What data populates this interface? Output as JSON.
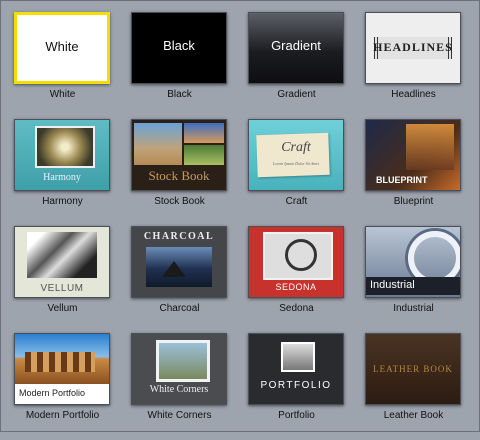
{
  "themes": [
    {
      "label": "White",
      "title": "White",
      "selected": true
    },
    {
      "label": "Black",
      "title": "Black"
    },
    {
      "label": "Gradient",
      "title": "Gradient"
    },
    {
      "label": "Headlines",
      "title": "HEADLINES"
    },
    {
      "label": "Harmony",
      "title": "Harmony"
    },
    {
      "label": "Stock Book",
      "title": "Stock Book"
    },
    {
      "label": "Craft",
      "title": "Craft",
      "subtitle": "Lorem Ipsum Dolor Sit Amet"
    },
    {
      "label": "Blueprint",
      "title": "BLUEPRINT"
    },
    {
      "label": "Vellum",
      "title": "VELLUM"
    },
    {
      "label": "Charcoal",
      "title": "CHARCOAL"
    },
    {
      "label": "Sedona",
      "title": "SEDONA"
    },
    {
      "label": "Industrial",
      "title": "Industrial"
    },
    {
      "label": "Modern Portfolio",
      "title": "Modern Portfolio"
    },
    {
      "label": "White Corners",
      "title": "White Corners"
    },
    {
      "label": "Portfolio",
      "title": "PORTFOLIO"
    },
    {
      "label": "Leather Book",
      "title": "LEATHER BOOK"
    }
  ],
  "colors": {
    "selection": "#f2de00",
    "background": "#9ea4ae"
  }
}
